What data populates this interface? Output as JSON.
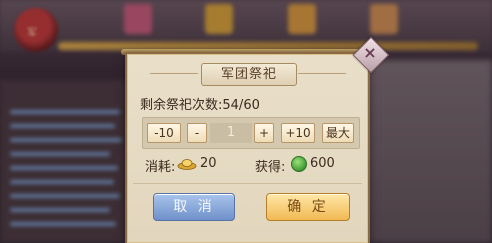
{
  "dialog": {
    "title": "军团祭祀",
    "remaining_label": "剩余祭祀次数:",
    "remaining_value": "54/60",
    "controls": {
      "minus10": "-10",
      "minus": "-",
      "quantity": "1",
      "plus": "+",
      "plus10": "+10",
      "max": "最大"
    },
    "cost_label": "消耗:",
    "cost_value": "20",
    "gain_label": "获得:",
    "gain_value": "600",
    "cancel_label": "取 消",
    "confirm_label": "确 定"
  },
  "background": {
    "avatar_text": "军"
  },
  "colors": {
    "confirm": "#f1b953",
    "cancel": "#6f90c9",
    "dialog_bg": "#e6dbc4"
  }
}
